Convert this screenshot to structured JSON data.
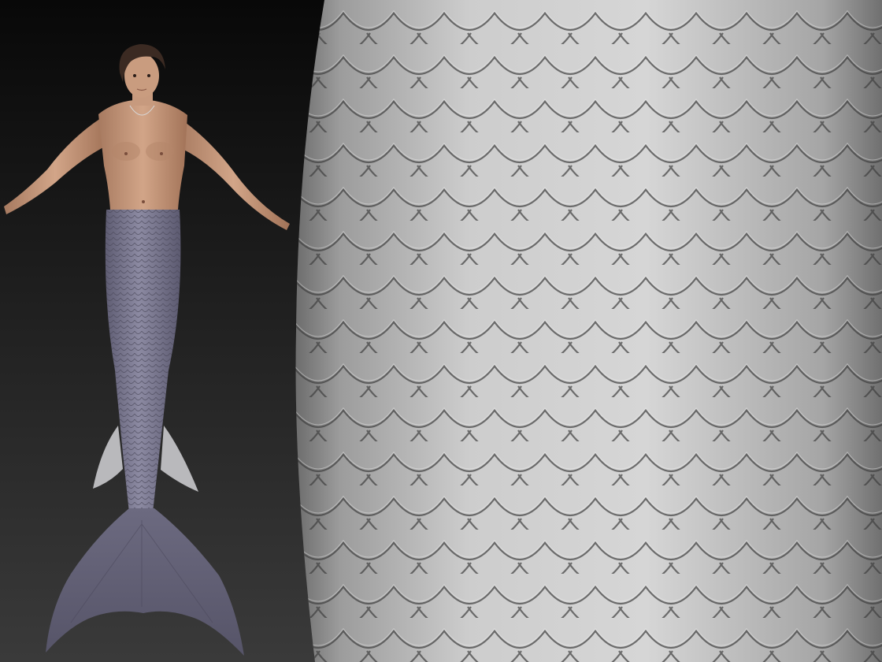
{
  "viewport": {
    "background_top": "#080808",
    "background_bottom": "#3a3a3a"
  },
  "model": {
    "skin_color": "#c4987c",
    "hair_color": "#3b2a22",
    "tail_color": "#7c7a92",
    "fin_color": "#b9b9bc"
  },
  "closeup": {
    "scale_color": "#c9c9c9",
    "scale_edge_color": "#3e3e3e"
  }
}
